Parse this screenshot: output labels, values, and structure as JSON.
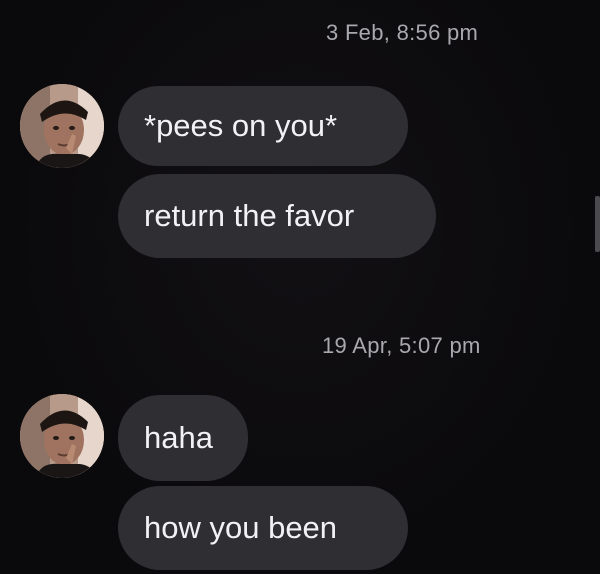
{
  "conversation": {
    "groups": [
      {
        "timestamp": "3 Feb, 8:56 pm",
        "messages": [
          "*pees on you*",
          "return the favor"
        ]
      },
      {
        "timestamp": "19 Apr, 5:07 pm",
        "messages": [
          "haha",
          "how you been"
        ]
      }
    ]
  },
  "colors": {
    "background": "#0b0a0c",
    "bubble": "#2f2e33",
    "bubble_text": "#f2f2f4",
    "timestamp_text": "#a9a8ad"
  },
  "icons": {
    "avatar": "profile-photo"
  }
}
